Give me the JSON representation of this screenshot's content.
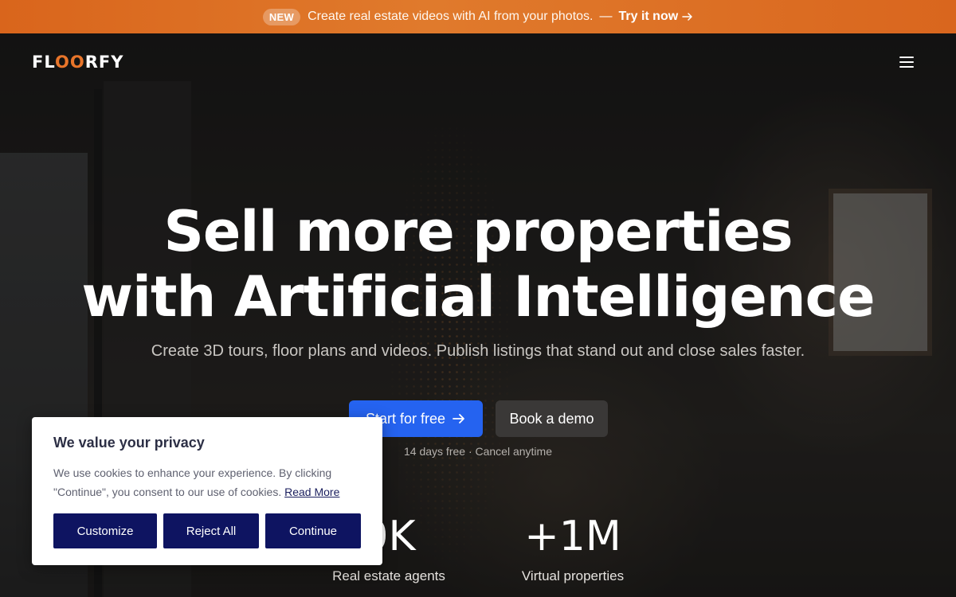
{
  "announcement": {
    "badge": "NEW",
    "message": "Create real estate videos with AI from your photos.",
    "separator": "—",
    "cta": "Try it now",
    "bar_color": "#e07a2c"
  },
  "header": {
    "logo": {
      "part1": "FL",
      "part2": "OO",
      "part3": "RFY"
    },
    "menu_icon": "hamburger-menu-icon"
  },
  "hero": {
    "headline_line1": "Sell more properties",
    "headline_line2": "with Artificial Intelligence",
    "subtitle": "Create 3D tours, floor plans and videos. Publish listings that stand out and close sales faster.",
    "primary_button": "Start for free",
    "primary_icon": "arrow-right-icon",
    "secondary_button": "Book a demo",
    "trial_note": "14 days free · Cancel anytime",
    "primary_color": "#2563f0"
  },
  "stats": [
    {
      "value": "0K",
      "label": "Real estate agents"
    },
    {
      "value": "+1M",
      "label": "Virtual properties"
    }
  ],
  "cookie_banner": {
    "title": "We value your privacy",
    "body": "We use cookies to enhance your experience. By clicking \"Continue\", you consent to our use of cookies.",
    "read_more": "Read More",
    "buttons": {
      "customize": "Customize",
      "reject": "Reject All",
      "continue": "Continue"
    },
    "button_color": "#0e1461"
  }
}
